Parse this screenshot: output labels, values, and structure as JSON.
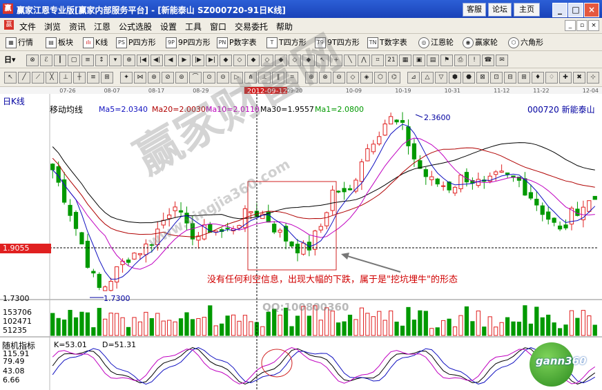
{
  "titlebar": {
    "title": "赢家江恩专业版[赢家内部服务平台] - [新能泰山   SZ000720-91日K线]",
    "buttons": [
      "客服",
      "论坛",
      "主页"
    ],
    "window_controls": [
      "_",
      "□",
      "×"
    ]
  },
  "menu": {
    "items": [
      "文件",
      "浏览",
      "资讯",
      "江恩",
      "公式选股",
      "设置",
      "工具",
      "窗口",
      "交易委托",
      "帮助"
    ]
  },
  "toolbar1": {
    "items": [
      {
        "icon": "grid",
        "label": "行情"
      },
      {
        "icon": "blocks",
        "label": "板块"
      },
      {
        "icon": "candles",
        "label": "K线"
      },
      {
        "icon": "PS",
        "label": "P四方形"
      },
      {
        "icon": "9P",
        "label": "9P四方形"
      },
      {
        "icon": "PN",
        "label": "P数字表"
      },
      {
        "icon": "T",
        "label": "T四方形"
      },
      {
        "icon": "T9",
        "label": "9T四方形"
      },
      {
        "icon": "TN",
        "label": "T数字表"
      },
      {
        "icon": "wheel",
        "label": "江恩轮"
      },
      {
        "icon": "wheel",
        "label": "赢家轮"
      },
      {
        "icon": "hex",
        "label": "六角形"
      }
    ]
  },
  "chart_header": {
    "period": "日K线",
    "indicator": "移动均线",
    "ma5": "Ma5=2.0340",
    "ma20": "Ma20=2.0030",
    "ma10": "Ma10=2.0110",
    "ma30": "Ma30=1.9557",
    "ma1": "Ma1=2.0800",
    "stock": "000720 新能泰山"
  },
  "date_axis": [
    "07-26",
    "08-07",
    "08-17",
    "08-29",
    "2012-09-12",
    "09-20",
    "10-09",
    "10-19",
    "10-31",
    "11-12",
    "11-22",
    "12-04"
  ],
  "price_labels": {
    "high": "2.3600",
    "low": "1.7300",
    "cursor": "1.9055",
    "axis_low": "1.7300"
  },
  "annotation": "没有任何利空信息，出现大幅的下跌，属于是\"挖坑埋牛\"的形态",
  "watermarks": {
    "main": "赢家财富网",
    "url": "www.yingjia360.com",
    "qq": "QQ:100800360",
    "logo": "gann360"
  },
  "volume_axis": [
    "153706",
    "102471",
    "51235"
  ],
  "kdj": {
    "name": "随机指标",
    "k": "K=53.01",
    "d": "D=51.31",
    "axis": [
      "115.91",
      "79.49",
      "43.08",
      "6.66"
    ]
  },
  "colors": {
    "up": "#e02020",
    "down": "#009900",
    "ma5": "#1010c0",
    "ma10": "#c000c0",
    "ma20": "#b00000",
    "ma30": "#000000",
    "title_bg": "#1c46bd"
  }
}
